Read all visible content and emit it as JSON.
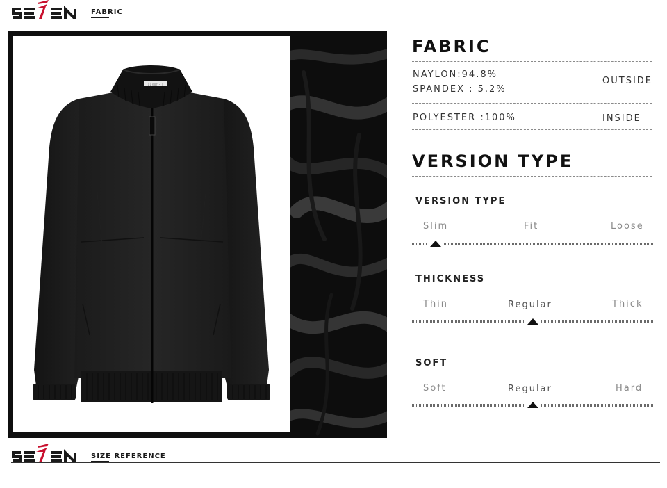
{
  "brand": "SEVEN",
  "top_bar": {
    "tag": "FABRIC"
  },
  "bottom_bar": {
    "tag": "SIZE REFERENCE"
  },
  "jacket_tag_text": "ᛈᛈᚱᛟᚨ - ᛚ",
  "fabric": {
    "title": "FABRIC",
    "outside": {
      "lines": [
        "NAYLON:94.8%",
        "SPANDEX : 5.2%"
      ],
      "label": "OUTSIDE"
    },
    "inside": {
      "lines": [
        "POLYESTER :100%"
      ],
      "label": "INSIDE"
    }
  },
  "version": {
    "title": "VERSION TYPE",
    "scales": [
      {
        "name": "VERSION TYPE",
        "options": [
          "Slim",
          "Fit",
          "Loose"
        ],
        "selected": "Slim"
      },
      {
        "name": "THICKNESS",
        "options": [
          "Thin",
          "Regular",
          "Thick"
        ],
        "selected": "Regular"
      },
      {
        "name": "SOFT",
        "options": [
          "Soft",
          "Regular",
          "Hard"
        ],
        "selected": "Regular"
      }
    ]
  },
  "colors": {
    "brand_red": "#c8102e",
    "text_dark": "#111111",
    "label_gray": "#8a8a8a"
  }
}
